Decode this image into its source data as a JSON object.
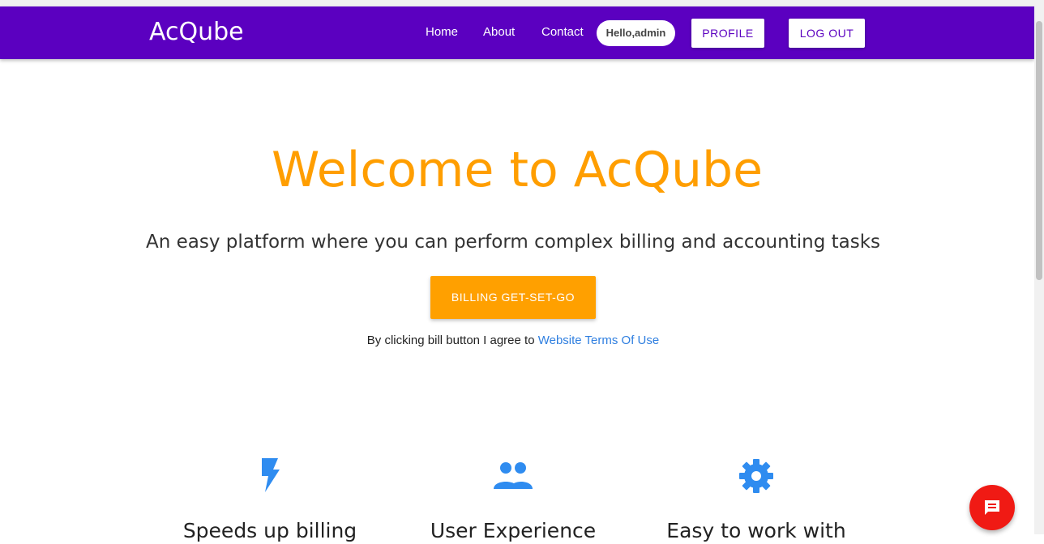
{
  "navbar": {
    "brand": "AcQube",
    "links": [
      "Home",
      "About",
      "Contact"
    ],
    "greeting": "Hello,admin",
    "profile_label": "PROFILE",
    "logout_label": "LOG OUT",
    "color": "#5b00c0"
  },
  "hero": {
    "title": "Welcome to AcQube",
    "subtitle": "An easy platform where you can perform complex billing and accounting tasks",
    "cta_label": "BILLING GET-SET-GO",
    "terms_text": "By clicking bill button I agree to ",
    "terms_link": "Website Terms Of Use",
    "accent": "#ff9e00"
  },
  "features": [
    {
      "icon": "lightning-bolt-icon",
      "title": "Speeds up billing"
    },
    {
      "icon": "people-icon",
      "title": "User Experience"
    },
    {
      "icon": "gear-icon",
      "title": "Easy to work with"
    }
  ],
  "chat": {
    "icon": "chat-icon",
    "color": "#f01a14"
  }
}
